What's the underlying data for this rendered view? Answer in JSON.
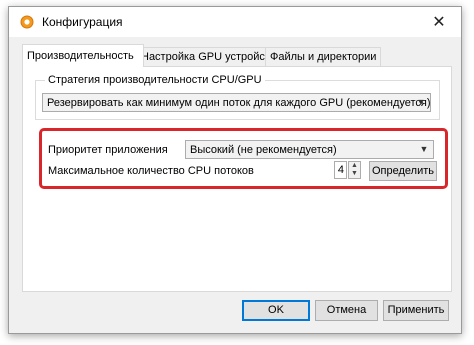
{
  "window": {
    "title": "Конфигурация",
    "close_glyph": "✕"
  },
  "tabs": [
    {
      "label": "Производительность",
      "active": true
    },
    {
      "label": "Настройка GPU устройств",
      "active": false
    },
    {
      "label": "Файлы и директории",
      "active": false
    }
  ],
  "strategy": {
    "group_label": "Стратегия производительности CPU/GPU",
    "value": "Резервировать как минимум один поток для каждого GPU (рекомендуется)"
  },
  "priority": {
    "label": "Приоритет приложения",
    "value": "Высокий (не рекомендуется)"
  },
  "cpu_threads": {
    "label": "Максимальное количество CPU потоков",
    "value": "4",
    "detect_label": "Определить"
  },
  "footer": {
    "ok_label": "OK",
    "cancel_label": "Отмена",
    "apply_label": "Применить"
  },
  "colors": {
    "highlight": "#d9262b",
    "accent": "#0078d7"
  },
  "icons": {
    "app": "gear-icon",
    "close": "close-icon",
    "dropdown": "chevron-down-icon"
  }
}
